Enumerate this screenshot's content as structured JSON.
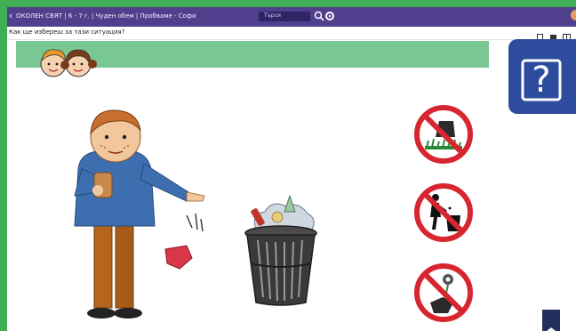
{
  "window": {
    "back_icon": "‹",
    "title": "ОКОЛЕН СВЯТ | 6 - 7 г. | Чуден обем | Пробвамe - Софи",
    "search_placeholder": "Търси",
    "search_icon": "search-icon",
    "settings_icon": "gear-icon"
  },
  "question": {
    "text": "Как ще избереш за тази ситуация?",
    "tools": [
      "bookmark-icon",
      "page-icon",
      "window-icon"
    ]
  },
  "help": {
    "label": "?"
  },
  "colors": {
    "frame_green": "#3fae54",
    "topbar": "#4f3f8c",
    "band": "#79c792",
    "help": "#2e4c9e",
    "prohibition_red": "#d72630"
  },
  "illustrations": {
    "signs": [
      "no-stepping-on-grass-sign",
      "no-littering-sign",
      "no-picking-flowers-sign"
    ],
    "figures": [
      "boy-littering",
      "trash-bin",
      "kids-avatars"
    ]
  }
}
